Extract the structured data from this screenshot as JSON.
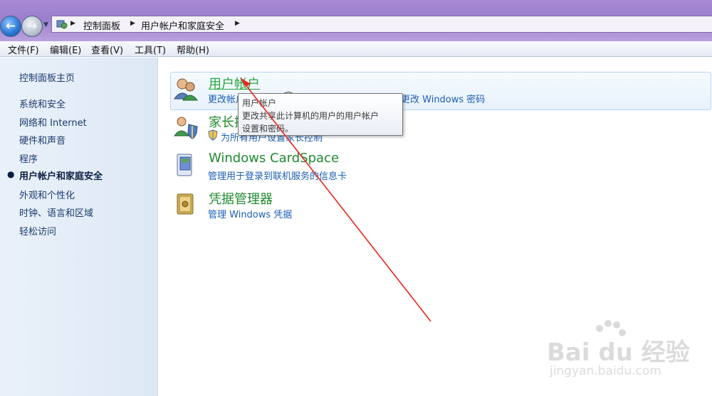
{
  "address_bar": {
    "crumbs": [
      "控制面板",
      "用户帐户和家庭安全"
    ]
  },
  "menu": [
    "文件(F)",
    "编辑(E)",
    "查看(V)",
    "工具(T)",
    "帮助(H)"
  ],
  "sidebar": {
    "home": "控制面板主页",
    "items": [
      {
        "label": "系统和安全",
        "current": false
      },
      {
        "label": "网络和 Internet",
        "current": false
      },
      {
        "label": "硬件和声音",
        "current": false
      },
      {
        "label": "程序",
        "current": false
      },
      {
        "label": "用户帐户和家庭安全",
        "current": true
      },
      {
        "label": "外观和个性化",
        "current": false
      },
      {
        "label": "时钟、语言和区域",
        "current": false
      },
      {
        "label": "轻松访问",
        "current": false
      }
    ]
  },
  "categories": [
    {
      "title": "用户帐户",
      "icon": "users-icon",
      "tasks": [
        "更改帐户图片",
        "更改 Windows 密码"
      ]
    },
    {
      "title": "家长控制",
      "icon": "parental-controls-icon",
      "tasks": [
        "为所有用户设置家长控制"
      ]
    },
    {
      "title": "Windows CardSpace",
      "icon": "cardspace-icon",
      "tasks": [
        "管理用于登录到联机服务的信息卡"
      ]
    },
    {
      "title": "凭据管理器",
      "icon": "credential-manager-icon",
      "tasks": [
        "管理 Windows 凭据"
      ]
    }
  ],
  "tooltip": {
    "title": "用户帐户",
    "lines": [
      "更改共享此计算机的用户的用户帐户",
      "设置和密码。"
    ]
  },
  "watermark": {
    "brand": "Bai du 经验",
    "url": "jingyan.baidu.com"
  },
  "colors": {
    "category_title": "#1f8a2e",
    "task_link": "#1e5fb4",
    "annotation_arrow": "#e8261f",
    "titlebar": "#a88ad6"
  }
}
